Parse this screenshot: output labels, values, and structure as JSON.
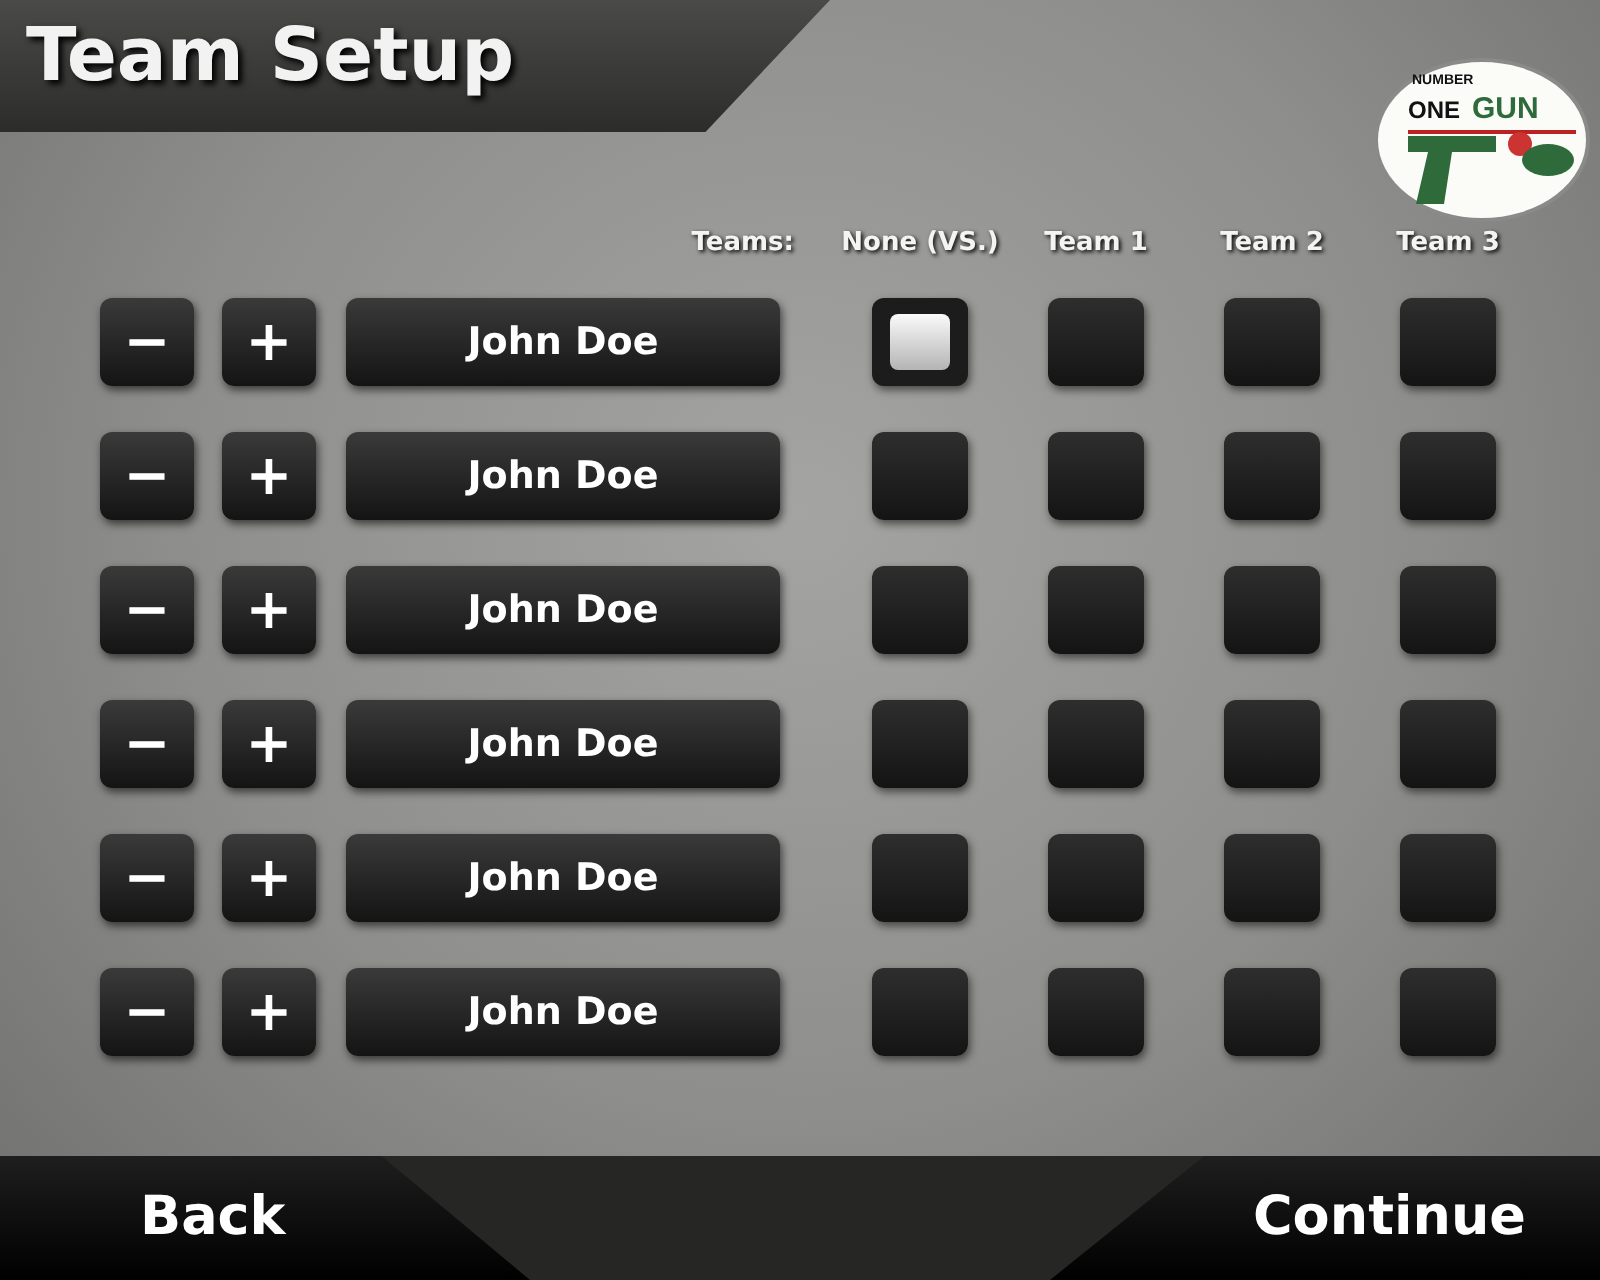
{
  "title": "Team Setup",
  "logo": {
    "lines": [
      "NUMBER",
      "ONE",
      "GUN"
    ]
  },
  "teams_label": "Teams:",
  "team_columns": [
    "None (VS.)",
    "Team 1",
    "Team 2",
    "Team 3"
  ],
  "players": [
    {
      "minus": "−",
      "plus": "+",
      "name": "John Doe",
      "teams": [
        {
          "selected": true
        },
        {
          "selected": false
        },
        {
          "selected": false
        },
        {
          "selected": false
        }
      ]
    },
    {
      "minus": "−",
      "plus": "+",
      "name": "John Doe",
      "teams": [
        {
          "selected": false
        },
        {
          "selected": false
        },
        {
          "selected": false
        },
        {
          "selected": false
        }
      ]
    },
    {
      "minus": "−",
      "plus": "+",
      "name": "John Doe",
      "teams": [
        {
          "selected": false
        },
        {
          "selected": false
        },
        {
          "selected": false
        },
        {
          "selected": false
        }
      ]
    },
    {
      "minus": "−",
      "plus": "+",
      "name": "John Doe",
      "teams": [
        {
          "selected": false
        },
        {
          "selected": false
        },
        {
          "selected": false
        },
        {
          "selected": false
        }
      ]
    },
    {
      "minus": "−",
      "plus": "+",
      "name": "John Doe",
      "teams": [
        {
          "selected": false
        },
        {
          "selected": false
        },
        {
          "selected": false
        },
        {
          "selected": false
        }
      ]
    },
    {
      "minus": "−",
      "plus": "+",
      "name": "John Doe",
      "teams": [
        {
          "selected": false
        },
        {
          "selected": false
        },
        {
          "selected": false
        },
        {
          "selected": false
        }
      ]
    }
  ],
  "footer": {
    "back": "Back",
    "continue": "Continue"
  }
}
